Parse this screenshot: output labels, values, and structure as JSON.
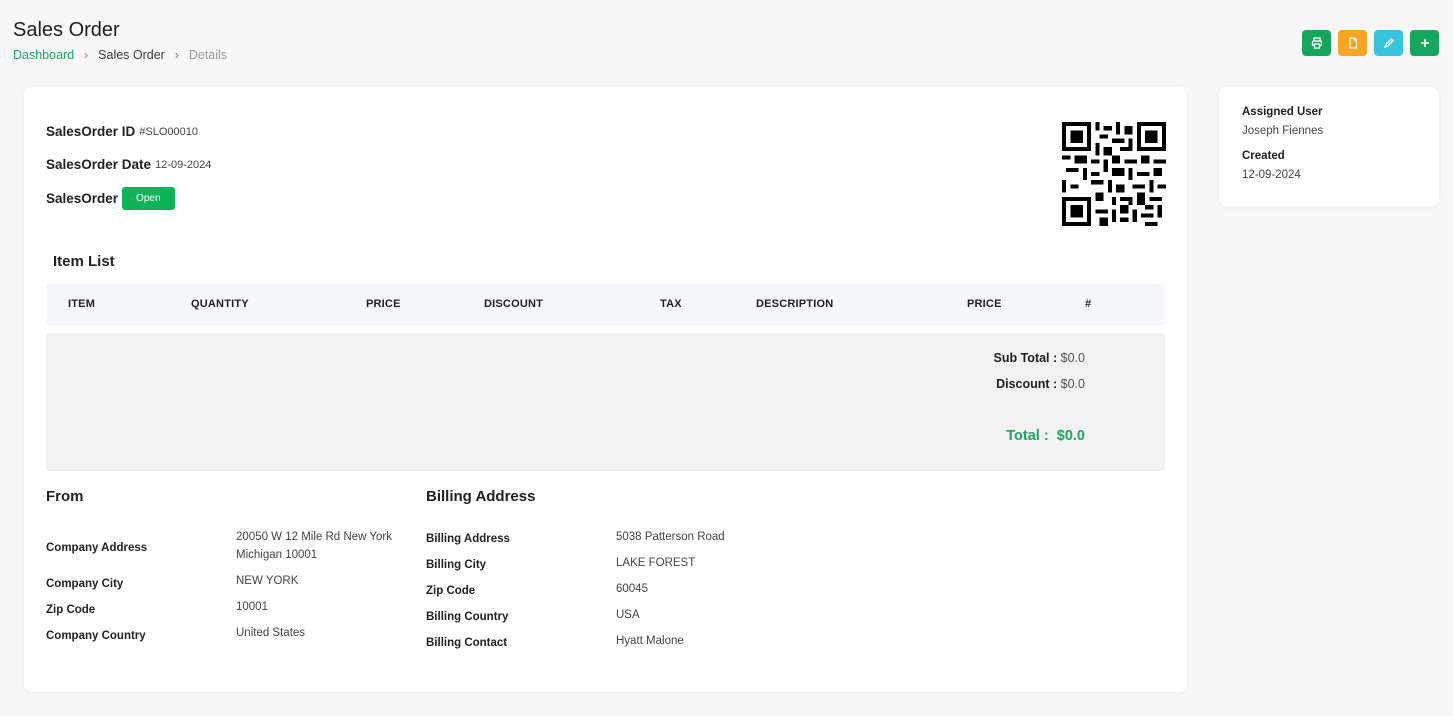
{
  "header": {
    "title": "Sales Order",
    "breadcrumb": [
      "Dashboard",
      "Sales Order",
      "Details"
    ]
  },
  "actions": [
    {
      "name": "print-icon",
      "color": "#15a55c"
    },
    {
      "name": "file-icon",
      "color": "#f9a521"
    },
    {
      "name": "pencil-icon",
      "color": "#39c4dd"
    },
    {
      "name": "plus-icon",
      "color": "#15a55c"
    }
  ],
  "order": {
    "id_label": "SalesOrder ID",
    "id_value": "#SLO00010",
    "date_label": "SalesOrder Date",
    "date_value": "12-09-2024",
    "status_label": "SalesOrder",
    "status_value": "Open",
    "status_color": "#0db55a"
  },
  "items": {
    "title": "Item List",
    "columns": [
      "ITEM",
      "QUANTITY",
      "PRICE",
      "DISCOUNT",
      "TAX",
      "DESCRIPTION",
      "PRICE",
      "#"
    ],
    "rows": []
  },
  "totals": {
    "subtotal_label": "Sub Total :",
    "subtotal_value": "$0.0",
    "discount_label": "Discount :",
    "discount_value": "$0.0",
    "total_label": "Total :",
    "total_value": "$0.0"
  },
  "from": {
    "title": "From",
    "fields": [
      {
        "label": "Company Address",
        "value_lines": [
          "20050 W 12 Mile Rd New York",
          "Michigan 10001"
        ]
      },
      {
        "label": "Company City",
        "value": "NEW YORK"
      },
      {
        "label": "Zip Code",
        "value": "10001"
      },
      {
        "label": "Company Country",
        "value": "United States"
      }
    ]
  },
  "billing": {
    "title": "Billing Address",
    "fields": [
      {
        "label": "Billing Address",
        "value": "5038 Patterson Road"
      },
      {
        "label": "Billing City",
        "value": "LAKE FOREST"
      },
      {
        "label": "Zip Code",
        "value": "60045"
      },
      {
        "label": "Billing Country",
        "value": "USA"
      },
      {
        "label": "Billing Contact",
        "value": "Hyatt Malone"
      }
    ]
  },
  "sidebar": {
    "assigned_label": "Assigned User",
    "assigned_value": "Joseph Fiennes",
    "created_label": "Created",
    "created_value": "12-09-2024"
  }
}
